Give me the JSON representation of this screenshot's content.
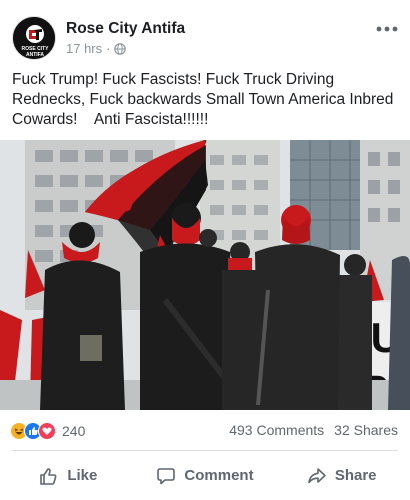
{
  "post": {
    "page_name": "Rose City Antifa",
    "timestamp": "17 hrs",
    "separator": "·",
    "privacy_icon": "globe-icon",
    "more_icon": "more-horizontal-icon",
    "avatar_text": "ROSE CITY\nANTIFA",
    "message": "Fuck Trump! Fuck Fascists! Fuck Truck Driving Rednecks, Fuck backwards Small Town America Inbred Cowards!    Anti Fascista!!!!!!"
  },
  "photo": {
    "banner_text_line1": "FU",
    "banner_text_line2": "TRU"
  },
  "engagement": {
    "reaction_icons": [
      "haha-icon",
      "like-icon",
      "love-icon"
    ],
    "reaction_count": "240",
    "comments": "493 Comments",
    "shares": "32 Shares"
  },
  "actions": {
    "like": "Like",
    "comment": "Comment",
    "share": "Share"
  },
  "colors": {
    "brand_blue": "#1877f2",
    "flag_red": "#c8191d",
    "flag_black": "#151515",
    "muted_text": "#606770"
  }
}
